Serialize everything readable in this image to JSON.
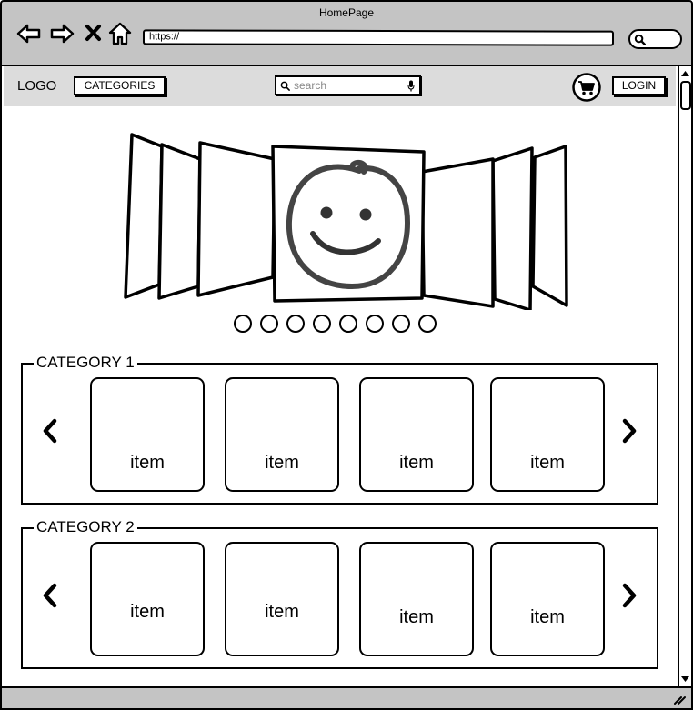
{
  "window": {
    "title": "HomePage",
    "url": "https://",
    "nav_icons": [
      "back-arrow-icon",
      "forward-arrow-icon",
      "stop-icon",
      "home-icon"
    ]
  },
  "header": {
    "logo": "LOGO",
    "categories_label": "CATEGORIES",
    "search": {
      "placeholder": "search",
      "icons": [
        "search-icon",
        "microphone-icon"
      ]
    },
    "cart_icon": "cart-icon",
    "login_label": "LOGIN"
  },
  "carousel": {
    "center_image": "smiley-face-icon",
    "slide_count": 8
  },
  "categories": [
    {
      "title": "CATEGORY 1",
      "items": [
        "item",
        "item",
        "item",
        "item"
      ]
    },
    {
      "title": "CATEGORY 2",
      "items": [
        "item",
        "item",
        "item",
        "item"
      ]
    }
  ]
}
